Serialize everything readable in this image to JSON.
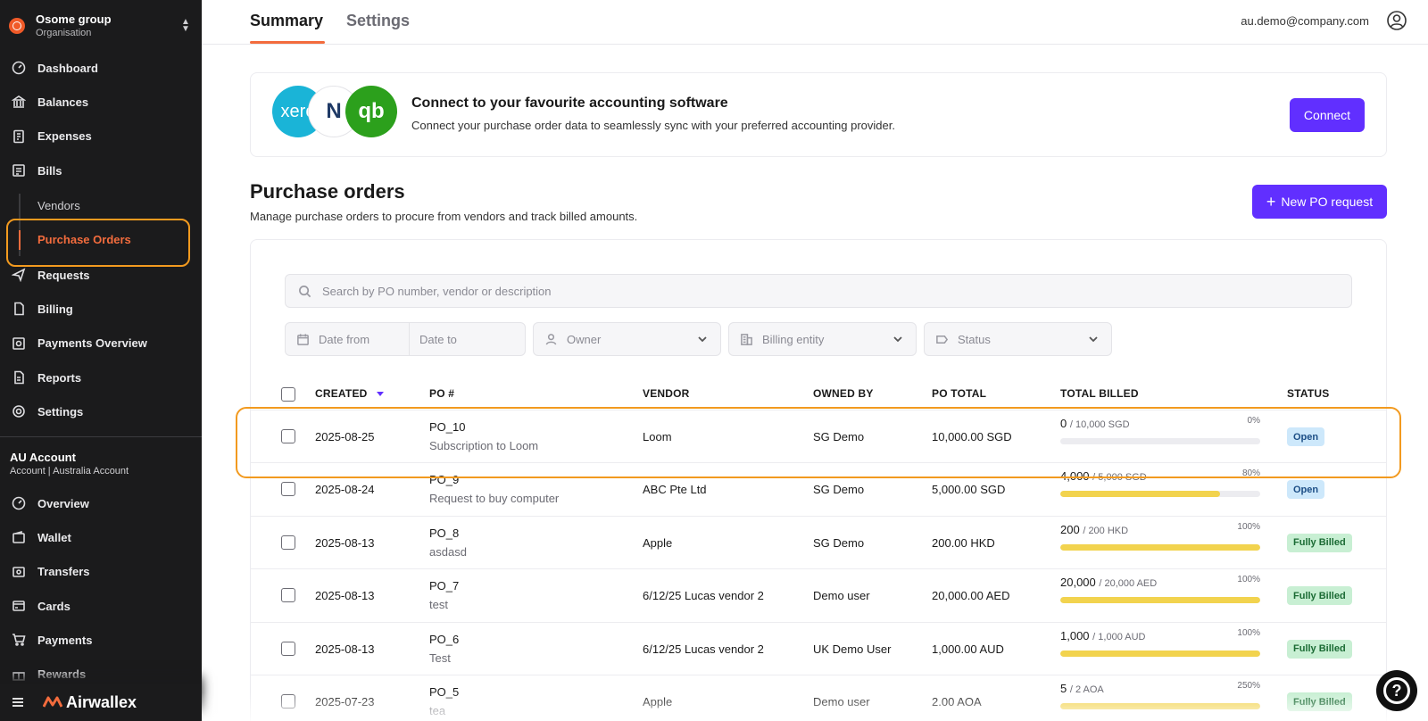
{
  "sidebar": {
    "org_name": "Osome group",
    "org_sub": "Organisation",
    "items": [
      {
        "label": "Dashboard",
        "icon": "dashboard-icon"
      },
      {
        "label": "Balances",
        "icon": "bank-icon"
      },
      {
        "label": "Expenses",
        "icon": "receipt-icon"
      },
      {
        "label": "Bills",
        "icon": "bills-icon"
      }
    ],
    "sub_items": [
      {
        "label": "Vendors"
      },
      {
        "label": "Purchase Orders",
        "active": true
      }
    ],
    "items2": [
      {
        "label": "Requests",
        "icon": "send-icon"
      },
      {
        "label": "Billing",
        "icon": "document-icon"
      },
      {
        "label": "Payments Overview",
        "icon": "payments-overview-icon"
      },
      {
        "label": "Reports",
        "icon": "report-icon"
      },
      {
        "label": "Settings",
        "icon": "gear-icon"
      }
    ],
    "account_title": "AU Account",
    "account_sub": "Account | Australia Account",
    "account_items": [
      {
        "label": "Overview",
        "icon": "overview-icon"
      },
      {
        "label": "Wallet",
        "icon": "wallet-icon"
      },
      {
        "label": "Transfers",
        "icon": "transfer-icon"
      },
      {
        "label": "Cards",
        "icon": "card-icon"
      },
      {
        "label": "Payments",
        "icon": "cart-icon"
      },
      {
        "label": "Rewards",
        "icon": "gift-icon"
      }
    ],
    "brand": "Airwallex"
  },
  "header": {
    "tabs": [
      {
        "label": "Summary",
        "active": true
      },
      {
        "label": "Settings",
        "active": false
      }
    ],
    "user_email": "au.demo@company.com"
  },
  "connect": {
    "title": "Connect to your favourite accounting software",
    "description": "Connect your purchase order data to seamlessly sync with your preferred accounting provider.",
    "button": "Connect",
    "logos": {
      "xero": "xero",
      "netsuite": "N",
      "quickbooks": "qb"
    }
  },
  "purchase_orders": {
    "title": "Purchase orders",
    "description": "Manage purchase orders to procure from vendors and track billed amounts.",
    "new_button": "New PO request",
    "search_placeholder": "Search by PO number, vendor or description",
    "filters": {
      "date_from": "Date from",
      "date_to": "Date to",
      "owner": "Owner",
      "billing_entity": "Billing entity",
      "status": "Status"
    },
    "columns": {
      "created": "CREATED",
      "po": "PO #",
      "vendor": "VENDOR",
      "owned_by": "OWNED BY",
      "po_total": "PO TOTAL",
      "total_billed": "TOTAL BILLED",
      "status": "STATUS"
    },
    "rows": [
      {
        "created": "2025-08-25",
        "po": "PO_10",
        "desc": "Subscription to Loom",
        "vendor": "Loom",
        "owner": "SG Demo",
        "total": "10,000.00 SGD",
        "billed": "0",
        "billed_of": "/ 10,000 SGD",
        "pct": "0%",
        "progress": 0,
        "status": "Open",
        "status_type": "open"
      },
      {
        "created": "2025-08-24",
        "po": "PO_9",
        "desc": "Request to buy computer",
        "vendor": "ABC Pte Ltd",
        "owner": "SG Demo",
        "total": "5,000.00 SGD",
        "billed": "4,000",
        "billed_of": "/ 5,000 SGD",
        "pct": "80%",
        "progress": 0.8,
        "status": "Open",
        "status_type": "open"
      },
      {
        "created": "2025-08-13",
        "po": "PO_8",
        "desc": "asdasd",
        "vendor": "Apple",
        "owner": "SG Demo",
        "total": "200.00 HKD",
        "billed": "200",
        "billed_of": "/ 200 HKD",
        "pct": "100%",
        "progress": 1,
        "status": "Fully Billed",
        "status_type": "billed"
      },
      {
        "created": "2025-08-13",
        "po": "PO_7",
        "desc": "test",
        "vendor": "6/12/25 Lucas vendor 2",
        "owner": "Demo user",
        "total": "20,000.00 AED",
        "billed": "20,000",
        "billed_of": "/ 20,000 AED",
        "pct": "100%",
        "progress": 1,
        "status": "Fully Billed",
        "status_type": "billed"
      },
      {
        "created": "2025-08-13",
        "po": "PO_6",
        "desc": "Test",
        "vendor": "6/12/25 Lucas vendor 2",
        "owner": "UK Demo User",
        "total": "1,000.00 AUD",
        "billed": "1,000",
        "billed_of": "/ 1,000 AUD",
        "pct": "100%",
        "progress": 1,
        "status": "Fully Billed",
        "status_type": "billed"
      },
      {
        "created": "2025-07-23",
        "po": "PO_5",
        "desc": "tea",
        "vendor": "Apple",
        "owner": "Demo user",
        "total": "2.00 AOA",
        "billed": "5",
        "billed_of": "/ 2 AOA",
        "pct": "250%",
        "progress": 1,
        "status": "Fully Billed",
        "status_type": "billed"
      }
    ]
  },
  "colors": {
    "accent": "#612fff",
    "brand_orange": "#f36c3d",
    "highlight": "#f29a1f",
    "progress": "#f2d34e"
  }
}
